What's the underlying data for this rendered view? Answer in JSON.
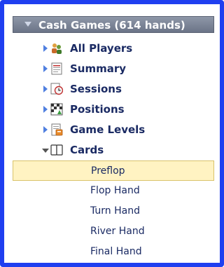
{
  "tree": {
    "header": "Cash Games (614 hands)",
    "items": [
      {
        "label": "All Players",
        "icon": "players-icon"
      },
      {
        "label": "Summary",
        "icon": "summary-report-icon"
      },
      {
        "label": "Sessions",
        "icon": "clock-icon"
      },
      {
        "label": "Positions",
        "icon": "positions-icon"
      },
      {
        "label": "Game Levels",
        "icon": "game-levels-icon"
      },
      {
        "label": "Cards",
        "icon": "cards-icon",
        "expanded": true
      }
    ],
    "cards_children": [
      "Preflop",
      "Flop Hand",
      "Turn Hand",
      "River Hand",
      "Final Hand"
    ],
    "selected": "Preflop"
  },
  "colors": {
    "frame": "#1f3ff0",
    "header_bg": "#7d8699",
    "selection_bg": "#fff3c2",
    "text": "#1a2a63"
  }
}
